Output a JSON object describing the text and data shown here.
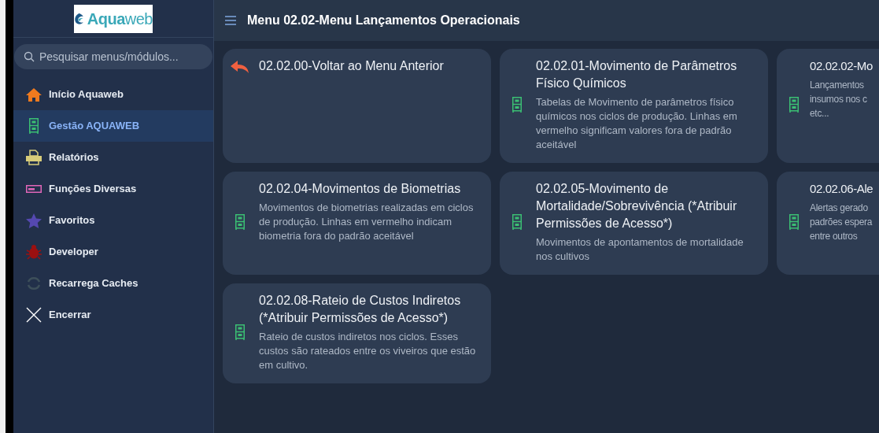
{
  "logo": {
    "text": "**Aqua**web"
  },
  "search": {
    "placeholder": "Pesquisar menus/módulos..."
  },
  "sidebar": {
    "items": [
      {
        "label": "Início Aquaweb",
        "selected": false
      },
      {
        "label": "Gestão AQUAWEB",
        "selected": true
      },
      {
        "label": "Relatórios",
        "selected": false
      },
      {
        "label": "Funções Diversas",
        "selected": false
      },
      {
        "label": "Favoritos",
        "selected": false
      },
      {
        "label": "Developer",
        "selected": false
      },
      {
        "label": "Recarrega Caches",
        "selected": false
      },
      {
        "label": "Encerrar",
        "selected": false
      }
    ]
  },
  "header": {
    "title": "Menu 02.02-Menu Lançamentos Operacionais"
  },
  "cards": [
    {
      "kind": "back",
      "title": "02.02.00-Voltar ao Menu Anterior"
    },
    {
      "kind": "module",
      "title": "02.02.01-Movimento de Parâmetros Físico Químicos",
      "description": "Tabelas de Movimento de parâmetros físico químicos nos ciclos de produção. Linhas em vermelho significam valores fora de padrão aceitável"
    },
    {
      "kind": "module",
      "title": "02.02.02-Mo",
      "description": "Lançamentos\ninsumos nos c\netc..."
    },
    {
      "kind": "module",
      "title": "02.02.04-Movimentos de Biometrias",
      "description": "Movimentos de biometrias realizadas em ciclos de produção. Linhas em vermelho indicam biometria fora do padrão aceitável"
    },
    {
      "kind": "module",
      "title": "02.02.05-Movimento de Mortalidade/Sobrevivência (*Atribuir Permissões de Acesso*)",
      "description": "Movimentos de apontamentos de mortalidade nos cultivos"
    },
    {
      "kind": "module",
      "title": "02.02.06-Ale",
      "description": "Alertas gerado\npadrões espera\nentre outros"
    },
    {
      "kind": "module",
      "title": "02.02.08-Rateio de Custos Indiretos (*Atribuir Permissões de Acesso*)",
      "description": "Rateio de custos indiretos nos ciclos. Esses custos são rateados entre os viveiros que estão em cultivo."
    }
  ]
}
